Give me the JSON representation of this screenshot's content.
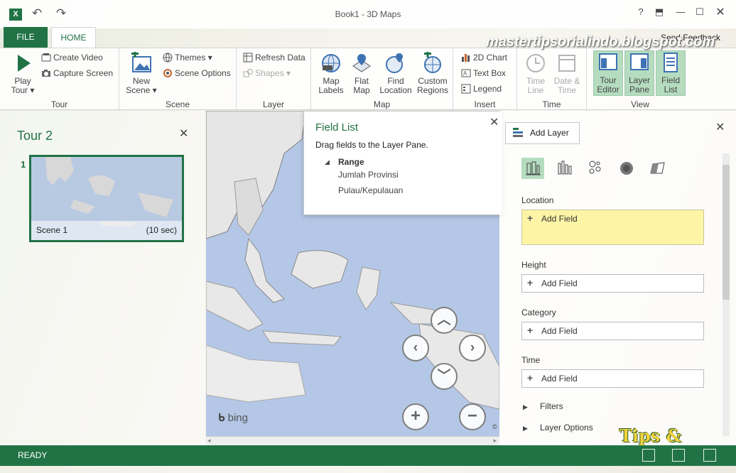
{
  "window": {
    "title": "Book1 - 3D Maps",
    "app_icon": "X"
  },
  "tabs": {
    "file": "FILE",
    "home": "HOME"
  },
  "feedback": "Send Feedback",
  "ribbon": {
    "tour": {
      "label": "Tour",
      "play": "Play",
      "play2": "Tour",
      "create_video": "Create Video",
      "capture_screen": "Capture Screen"
    },
    "scene": {
      "label": "Scene",
      "new": "New",
      "new2": "Scene",
      "themes": "Themes",
      "scene_options": "Scene Options"
    },
    "layer": {
      "label": "Layer",
      "refresh": "Refresh Data",
      "shapes": "Shapes"
    },
    "map": {
      "label": "Map",
      "map_labels_1": "Map",
      "map_labels_2": "Labels",
      "flat_map_1": "Flat",
      "flat_map_2": "Map",
      "find_location_1": "Find",
      "find_location_2": "Location",
      "custom_regions_1": "Custom",
      "custom_regions_2": "Regions"
    },
    "insert": {
      "label": "Insert",
      "chart": "2D Chart",
      "textbox": "Text Box",
      "legend": "Legend"
    },
    "time": {
      "label": "Time",
      "timeline_1": "Time",
      "timeline_2": "Line",
      "datetime_1": "Date &",
      "datetime_2": "Time"
    },
    "view": {
      "label": "View",
      "tour_editor_1": "Tour",
      "tour_editor_2": "Editor",
      "layer_pane_1": "Layer",
      "layer_pane_2": "Pane",
      "field_list_1": "Field",
      "field_list_2": "List"
    }
  },
  "tour_pane": {
    "title": "Tour 2",
    "scene_index": "1",
    "scene_name": "Scene 1",
    "scene_duration": "(10 sec)"
  },
  "field_list": {
    "title": "Field List",
    "subtitle": "Drag fields to the Layer Pane.",
    "table": "Range",
    "fields": [
      "Jumlah Provinsi",
      "Pulau/Kepulauan"
    ]
  },
  "layer_pane": {
    "add_layer": "Add Layer",
    "location": "Location",
    "height": "Height",
    "category": "Category",
    "time": "Time",
    "add_field": "Add Field",
    "filters": "Filters",
    "layer_options": "Layer Options"
  },
  "map": {
    "bing": "bing",
    "copyright": "©"
  },
  "status": {
    "text": "READY"
  },
  "watermark": {
    "blog": "mastertipsorialindo.blogspot.com",
    "tag": "Tips & Tutorial"
  },
  "colors": {
    "accent": "#217346",
    "location_well": "#fdf4a6"
  }
}
